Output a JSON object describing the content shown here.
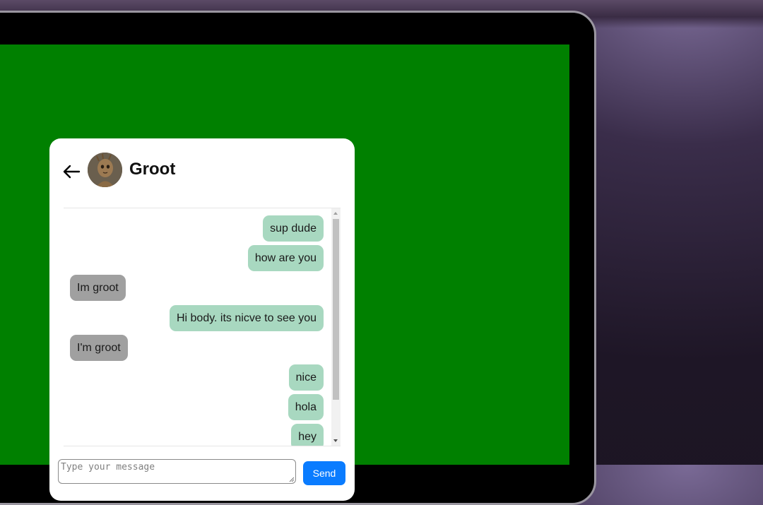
{
  "chat": {
    "contact_name": "Groot",
    "messages": [
      {
        "text": "sup dude",
        "side": "sent"
      },
      {
        "text": "how are you",
        "side": "sent"
      },
      {
        "text": "Im groot",
        "side": "received"
      },
      {
        "text": "Hi body. its nicve to see you",
        "side": "sent"
      },
      {
        "text": "I'm groot",
        "side": "received"
      },
      {
        "text": "nice",
        "side": "sent"
      },
      {
        "text": "hola",
        "side": "sent"
      },
      {
        "text": "hey",
        "side": "sent"
      }
    ]
  },
  "composer": {
    "placeholder": "Type your message",
    "send_label": "Send"
  },
  "colors": {
    "screen": "#008000",
    "sent_bubble": "#a8d8c0",
    "received_bubble": "#a0a0a0",
    "send_button": "#0a7cff"
  },
  "icons": {
    "back": "arrow-left-icon",
    "avatar": "groot-avatar"
  }
}
